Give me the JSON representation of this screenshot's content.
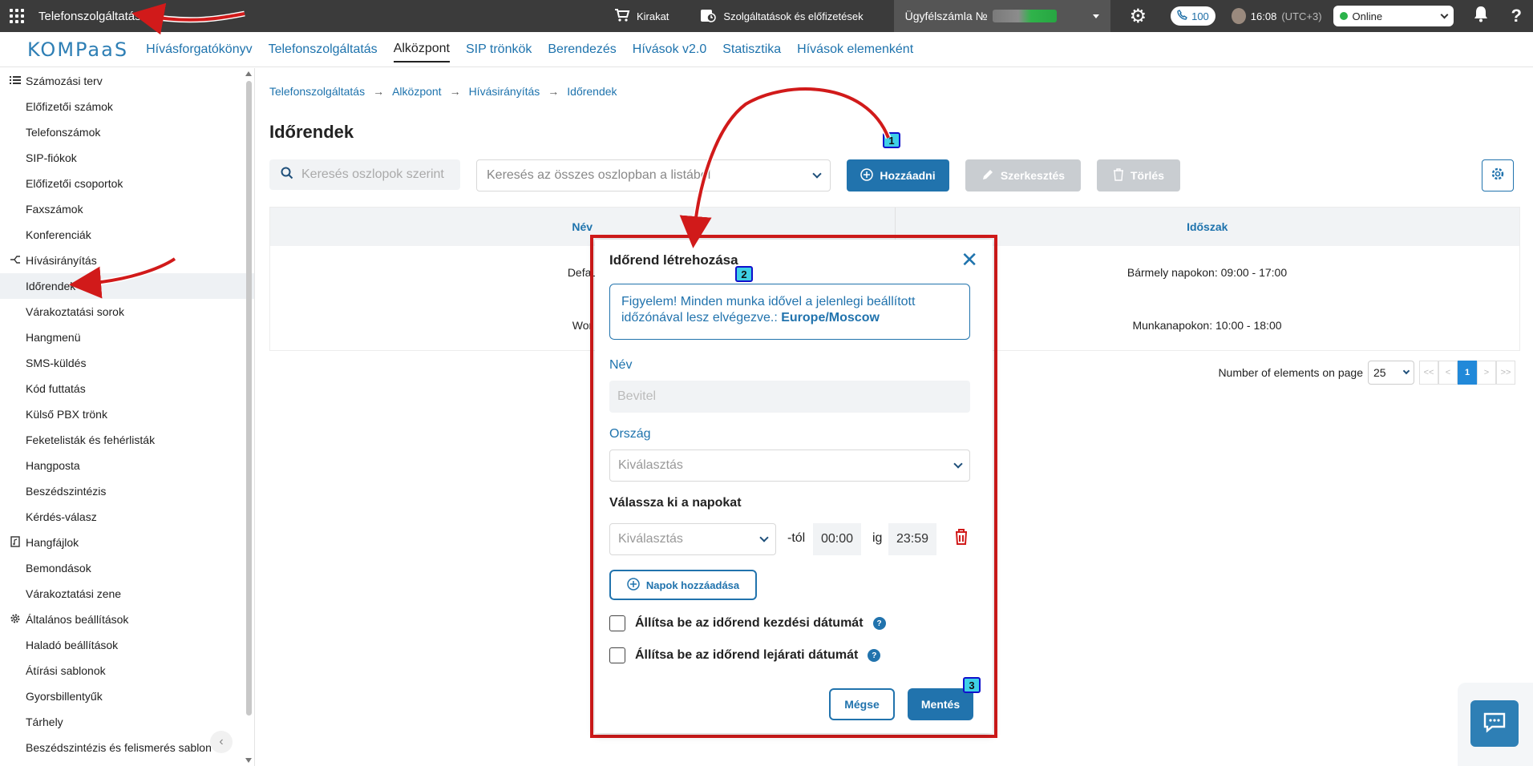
{
  "topbar": {
    "title": "Telefonszolgáltatás",
    "shop_label": "Kirakat",
    "services_label": "Szolgáltatások és előfizetések",
    "account_label": "Ügyfélszámla №",
    "phone_count": "100",
    "time": "16:08",
    "timezone": "(UTC+3)",
    "status": "Online",
    "status_color": "#2bb34a"
  },
  "nav": {
    "logo": "KOMPaaS",
    "items": [
      {
        "label": "Hívásforgatókönyv"
      },
      {
        "label": "Telefonszolgáltatás"
      },
      {
        "label": "Alközpont"
      },
      {
        "label": "SIP trönkök"
      },
      {
        "label": "Berendezés"
      },
      {
        "label": "Hívások v2.0"
      },
      {
        "label": "Statisztika"
      },
      {
        "label": "Hívások elemenként"
      }
    ]
  },
  "sidebar": {
    "group1": "Számozási terv",
    "group1_items": [
      "Előfizetői számok",
      "Telefonszámok",
      "SIP-fiókok",
      "Előfizetői csoportok",
      "Faxszámok",
      "Konferenciák"
    ],
    "group2": "Hívásirányítás",
    "group2_items": [
      "Időrendek",
      "Várakoztatási sorok",
      "Hangmenü",
      "SMS-küldés",
      "Kód futtatás",
      "Külső PBX trönk",
      "Feketelisták és fehérlisták",
      "Hangposta",
      "Beszédszintézis",
      "Kérdés-válasz"
    ],
    "group3": "Hangfájlok",
    "group3_items": [
      "Bemondások",
      "Várakoztatási zene"
    ],
    "group4": "Általános beállítások",
    "group4_items": [
      "Haladó beállítások",
      "Átírási sablonok",
      "Gyorsbillentyűk",
      "Tárhely",
      "Beszédszintézis és felismerés sablon"
    ]
  },
  "breadcrumb": [
    "Telefonszolgáltatás",
    "Alközpont",
    "Hívásirányítás",
    "Időrendek"
  ],
  "page": {
    "title": "Időrendek",
    "search_placeholder": "Keresés oszlopok szerint",
    "search_all_placeholder": "Keresés az összes oszlopban a listából",
    "add_label": "Hozzáadni",
    "edit_label": "Szerkesztés",
    "delete_label": "Törlés"
  },
  "table": {
    "headers": [
      "Név",
      "Időszak"
    ],
    "rows": [
      {
        "name": "Defau",
        "period": "Bármely napokon: 09:00 - 17:00"
      },
      {
        "name": "Wor",
        "period": "Munkanapokon: 10:00 - 18:00"
      }
    ]
  },
  "pager": {
    "label": "Number of elements on page",
    "per_page": "25",
    "first": "<<",
    "prev": "<",
    "current": "1",
    "next": ">",
    "last": ">>"
  },
  "modal": {
    "title": "Időrend létrehozása",
    "alert_text": "Figyelem! Minden munka idővel a jelenlegi beállított időzónával lesz elvégezve.:",
    "alert_tz": "Europe/Moscow",
    "name_label": "Név",
    "name_placeholder": "Bevitel",
    "country_label": "Ország",
    "country_placeholder": "Kiválasztás",
    "days_heading": "Válassza ki a napokat",
    "day_placeholder": "Kiválasztás",
    "from_suffix": "-tól",
    "from_time": "00:00",
    "to_word": "ig",
    "to_time": "23:59",
    "add_days_label": "Napok hozzáadása",
    "start_date_label": "Állítsa be az időrend kezdési dátumát",
    "end_date_label": "Állítsa be az időrend lejárati dátumát",
    "cancel_label": "Mégse",
    "save_label": "Mentés"
  },
  "badges": [
    "1",
    "2",
    "3"
  ],
  "colors": {
    "accent": "#2173ad",
    "highlight": "#d11a1a"
  }
}
